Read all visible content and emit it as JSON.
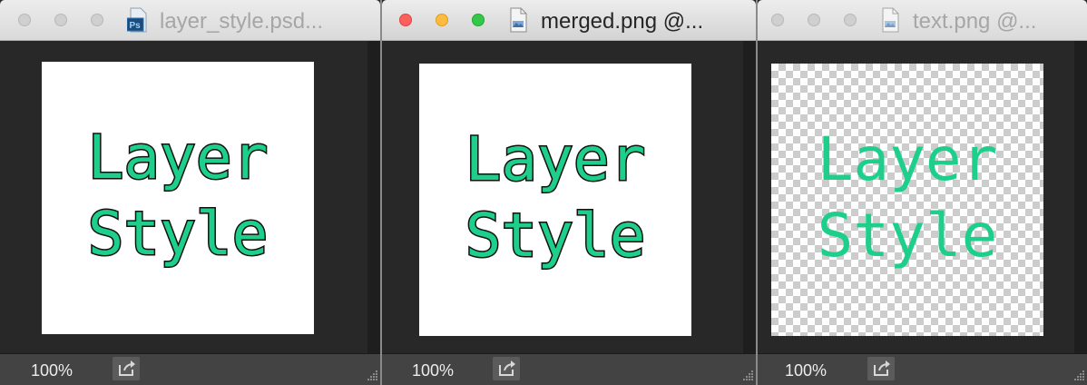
{
  "windows": [
    {
      "title": "layer_style.psd...",
      "file_icon": "photoshop-psd-icon",
      "badge": "Ps",
      "active": false,
      "zoom": "100%",
      "canvas_text": [
        "Layer",
        "Style"
      ],
      "canvas_style": "stroked"
    },
    {
      "title": "merged.png @...",
      "file_icon": "png-file-icon",
      "active": true,
      "zoom": "100%",
      "canvas_text": [
        "Layer",
        "Style"
      ],
      "canvas_style": "stroked"
    },
    {
      "title": "text.png @...",
      "file_icon": "png-file-icon",
      "active": false,
      "zoom": "100%",
      "canvas_text": [
        "Layer",
        "Style"
      ],
      "canvas_style": "transparent-plain"
    }
  ],
  "colors": {
    "text_fill": "#1ecf8b",
    "text_stroke": "#111111",
    "window_bg": "#282828",
    "status_bg": "#434343"
  }
}
